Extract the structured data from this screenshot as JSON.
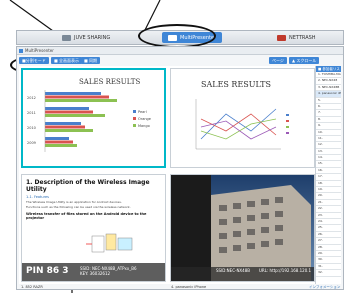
{
  "top_tabs": [
    {
      "label": "JUVE SHARING",
      "icon": "screen-share-icon"
    },
    {
      "label": "MultiPresenter",
      "icon": "multi-presenter-icon"
    },
    {
      "label": "NETTRASH",
      "icon": "net-icon"
    }
  ],
  "app": {
    "title": "MultiPresenter"
  },
  "toolbar": {
    "buttons": [
      "■分割モード",
      "■ 全画面表示",
      "■ 同期"
    ],
    "right_buttons": [
      "ページ",
      "▲ スクロール"
    ]
  },
  "right_list": {
    "header": "■ 参加者リスト",
    "items": [
      "1. TOSHIBA-MAX-B6",
      "2. NEC-NX48",
      "3. NEC-NX48B",
      "4. panasonic iPhone",
      "5.",
      "6.",
      "7.",
      "8.",
      "9.",
      "10.",
      "11.",
      "12.",
      "13.",
      "14.",
      "15.",
      "16.",
      "17.",
      "18.",
      "19.",
      "20.",
      "21.",
      "22.",
      "23.",
      "24.",
      "25.",
      "26.",
      "27.",
      "28.",
      "29.",
      "30.",
      "31.",
      "32."
    ],
    "footer": "▲ アクティブ参加者"
  },
  "panels": {
    "chart1": {
      "label": "",
      "chart_data": {
        "type": "bar",
        "title": "SALES RESULTS",
        "categories": [
          "2012",
          "2011",
          "2010",
          "2009"
        ],
        "series": [
          {
            "name": "Pearl",
            "values": [
              70,
              55,
              45,
              30
            ]
          },
          {
            "name": "Orange",
            "values": [
              80,
              60,
              50,
              35
            ]
          },
          {
            "name": "Mango",
            "values": [
              90,
              75,
              60,
              40
            ]
          }
        ]
      }
    },
    "chart2": {
      "label": "",
      "chart_data": {
        "type": "line",
        "title": "SALES RESULTS"
      }
    },
    "doc": {
      "label": "",
      "heading": "1. Description of the Wireless Image Utility",
      "sub": "1-1. Features",
      "line1": "The Wireless Image Utility is an application for Android devices.",
      "line2": "Functions such as the following can be used via the wireless network.",
      "bold": "Wireless transfer of files stored on the Android device to the projector",
      "pin": "PIN 86 3",
      "ssid": "SSID: NEC-NX48B_ATPxx_B6\nKEY: 36032612"
    },
    "photo": {
      "label": "",
      "ssid": "SSID:NEC-NX48B",
      "url": "URL: http://192.168.120.1"
    }
  },
  "bottom_labels": [
    "1. 852 RAZR",
    "4. panasonic iPhone"
  ],
  "bottom_right": "インフォメーション"
}
